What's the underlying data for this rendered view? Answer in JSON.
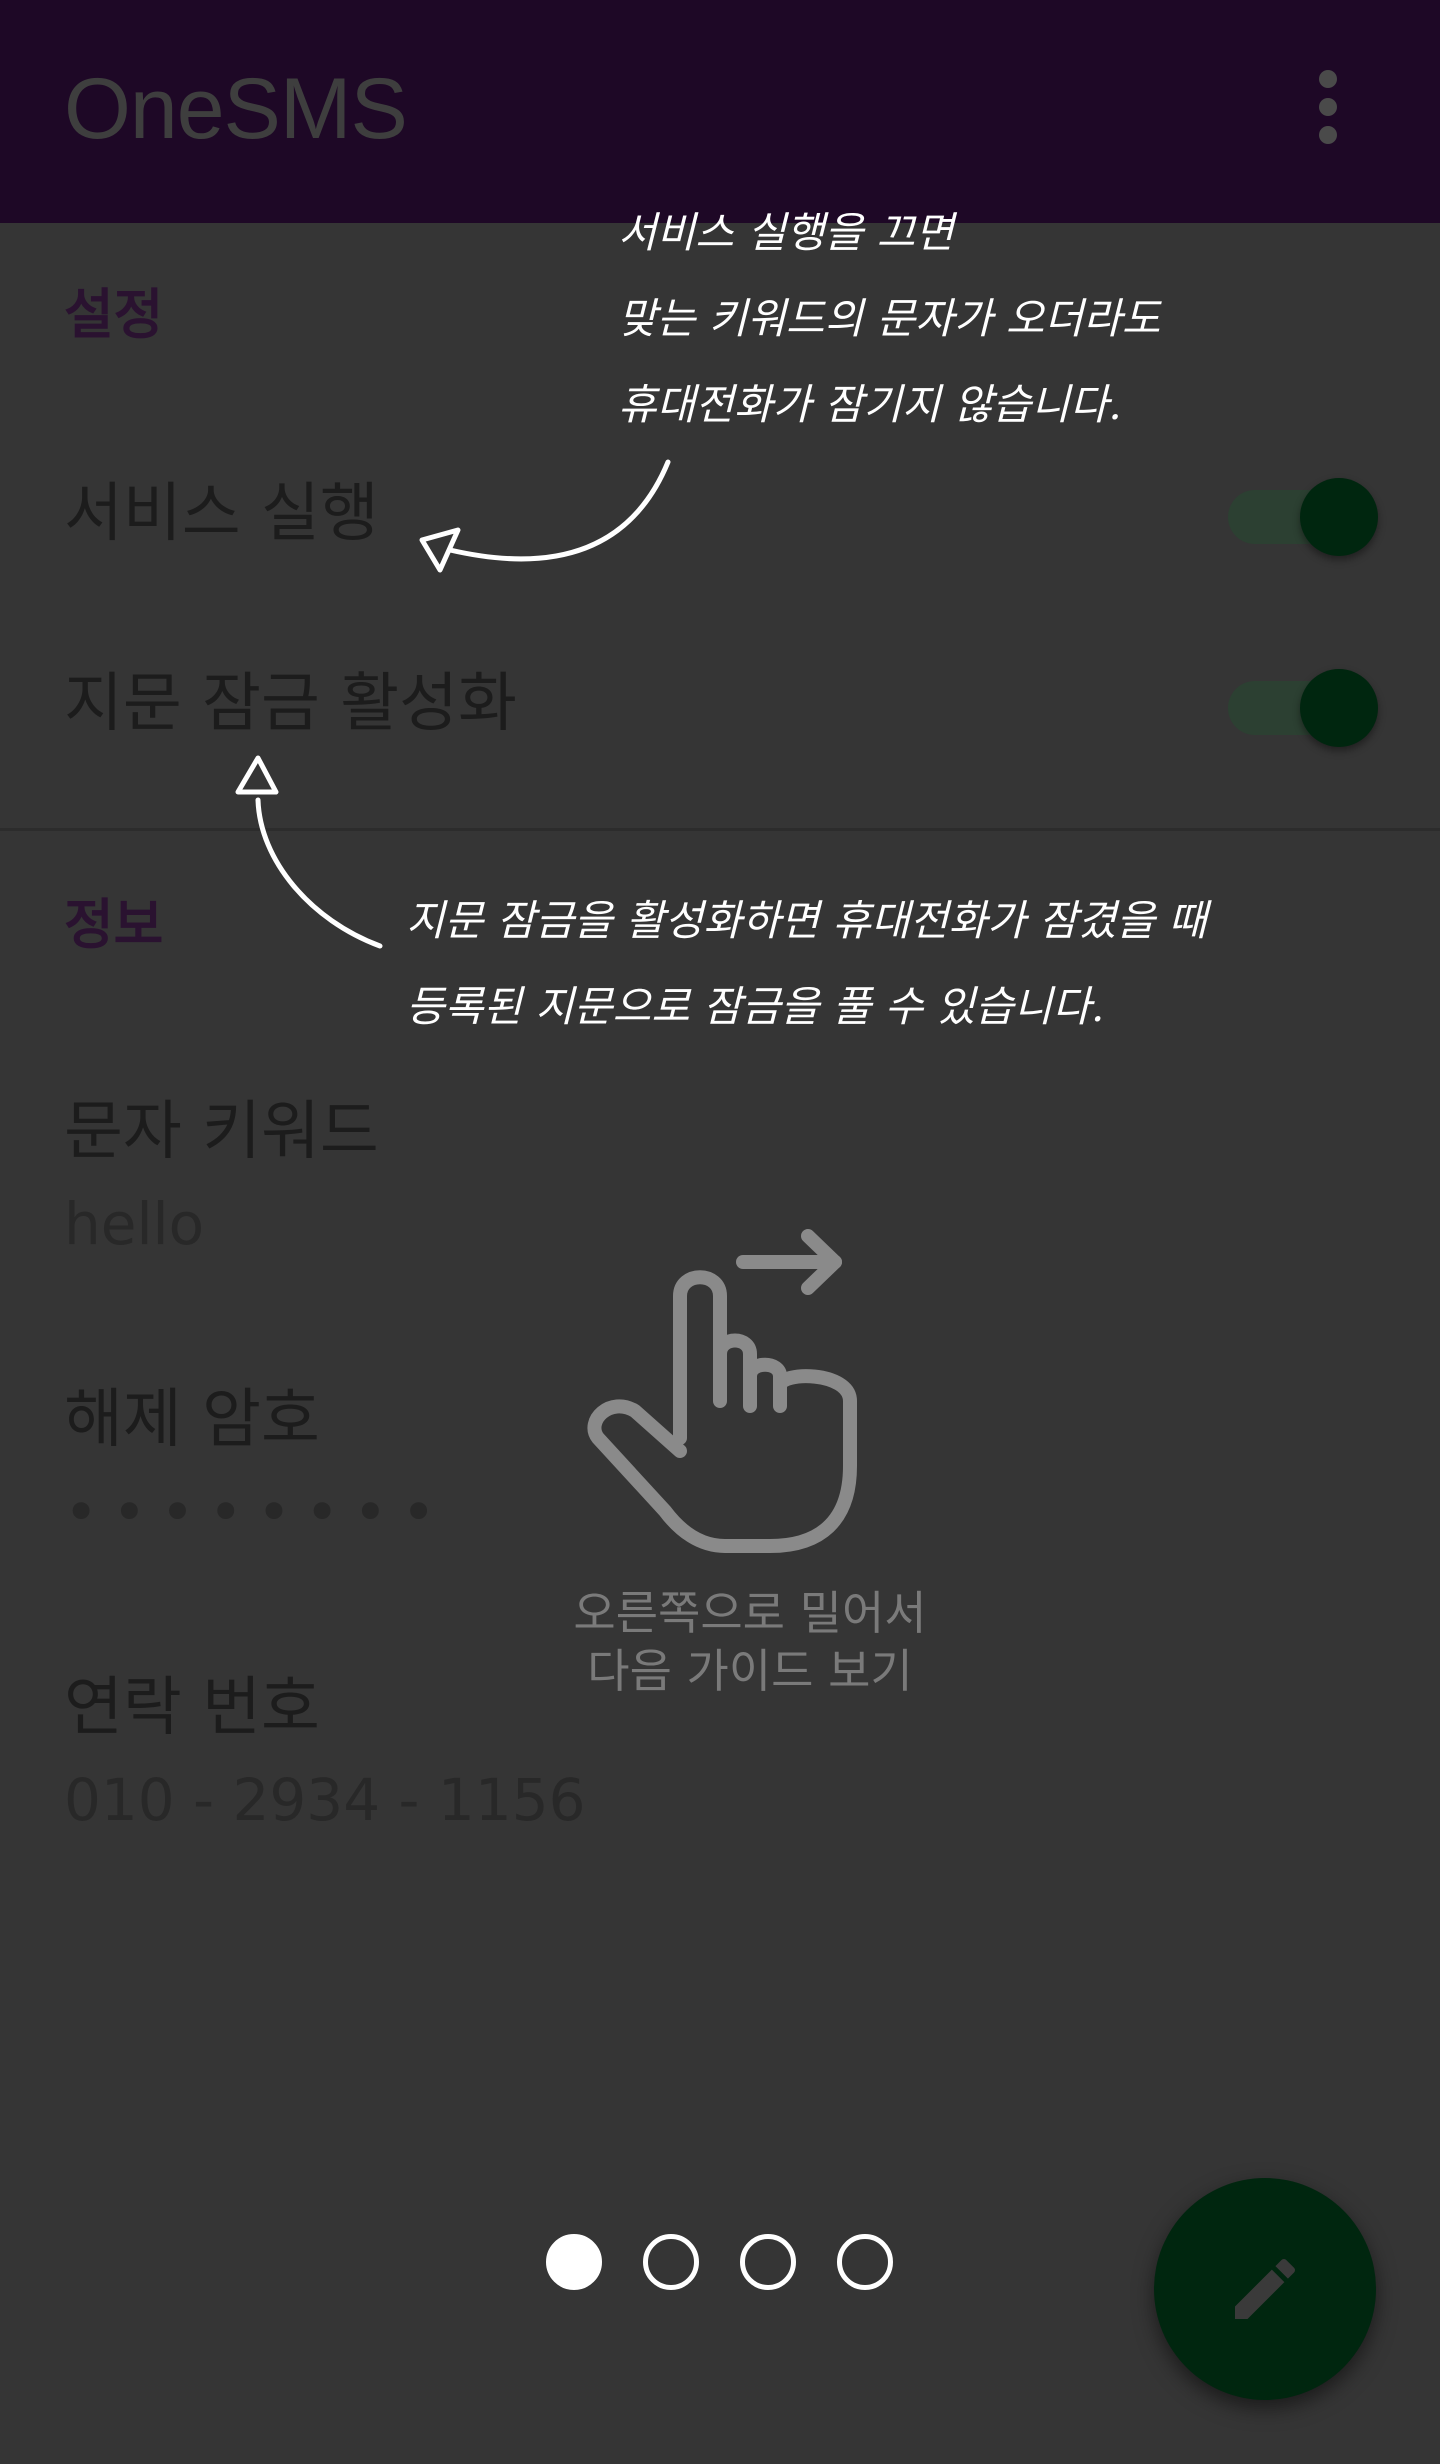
{
  "toolbar": {
    "title": "OneSMS",
    "menu_icon": "more-vert-icon"
  },
  "settings": {
    "section_label": "설정",
    "service_run": {
      "label": "서비스 실행",
      "enabled": true
    },
    "fingerprint_lock": {
      "label": "지문 잠금 활성화",
      "enabled": true
    }
  },
  "info": {
    "section_label": "정보",
    "sms_keyword": {
      "label": "문자 키워드",
      "value": "hello"
    },
    "unlock_password": {
      "label": "해제 암호",
      "value": "••••••••"
    },
    "contact_number": {
      "label": "연락 번호",
      "value": "010 - 2934 - 1156"
    }
  },
  "guide": {
    "note_service_lines": [
      "서비스 실행을 끄면",
      "맞는 키워드의 문자가 오더라도",
      "휴대전화가 잠기지 않습니다."
    ],
    "note_fingerprint_lines": [
      "지문 잠금을 활성화하면 휴대전화가 잠겼을 때",
      "등록된 지문으로 잠금을 풀 수 있습니다."
    ],
    "swipe_hint_lines": [
      "오른쪽으로 밀어서",
      "다음 가이드 보기"
    ],
    "page_indicator": {
      "total": 4,
      "current": 1
    },
    "swipe_icon": "swipe-right-hand-icon"
  },
  "fab": {
    "icon": "edit-pencil-icon"
  },
  "colors": {
    "toolbar_bg": "#1e0826",
    "overlay_bg": "#353535",
    "accent_green": "#00260f",
    "section_header": "#2a1230"
  }
}
